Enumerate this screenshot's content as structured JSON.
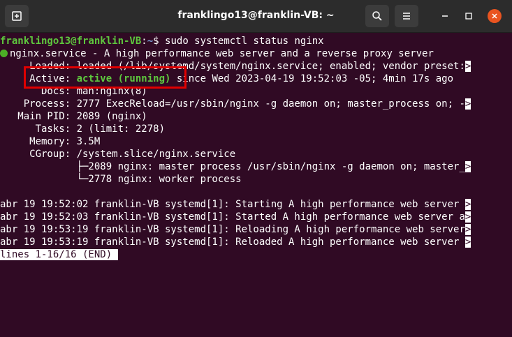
{
  "window": {
    "title": "franklingo13@franklin-VB: ~"
  },
  "colors": {
    "background": "#300a24",
    "titlebar": "#2c2c2c",
    "green": "#5ec73e",
    "blue": "#7d9fd6",
    "highlight": "#e00000",
    "close": "#e95420"
  },
  "icons": {
    "new_tab": "new-tab-icon",
    "search": "search-icon",
    "menu": "hamburger-menu-icon",
    "minimize": "minimize-icon",
    "maximize": "maximize-icon",
    "close": "close-icon"
  },
  "terminal": {
    "prompt_user": "franklingo13@franklin-VB",
    "prompt_sep": ":",
    "prompt_path": "~",
    "prompt_symbol": "$ ",
    "command": "sudo systemctl status nginx",
    "service_line": "nginx.service - A high performance web server and a reverse proxy server",
    "loaded_line": "     Loaded: loaded (/lib/systemd/system/nginx.service; enabled; vendor preset:",
    "overflow_marker": ">",
    "active_label": "     Active: ",
    "active_value": "active (running)",
    "active_rest": " since Wed 2023-04-19 19:52:03 -05; 4min 17s ago",
    "docs_line": "       Docs: man:nginx(8)",
    "process_line": "    Process: 2777 ExecReload=/usr/sbin/nginx -g daemon on; master_process on; -",
    "mainpid_line": "   Main PID: 2089 (nginx)",
    "tasks_line": "      Tasks: 2 (limit: 2278)",
    "memory_line": "     Memory: 3.5M",
    "cgroup_line": "     CGroup: /system.slice/nginx.service",
    "cgroup_child1": "             ├─2089 nginx: master process /usr/sbin/nginx -g daemon on; master_",
    "cgroup_child2": "             └─2778 nginx: worker process",
    "log_lines": [
      "abr 19 19:52:02 franklin-VB systemd[1]: Starting A high performance web server ",
      "abr 19 19:52:03 franklin-VB systemd[1]: Started A high performance web server a",
      "abr 19 19:53:19 franklin-VB systemd[1]: Reloading A high performance web server",
      "abr 19 19:53:19 franklin-VB systemd[1]: Reloaded A high performance web server "
    ],
    "pager_status": "lines 1-16/16 (END) "
  }
}
